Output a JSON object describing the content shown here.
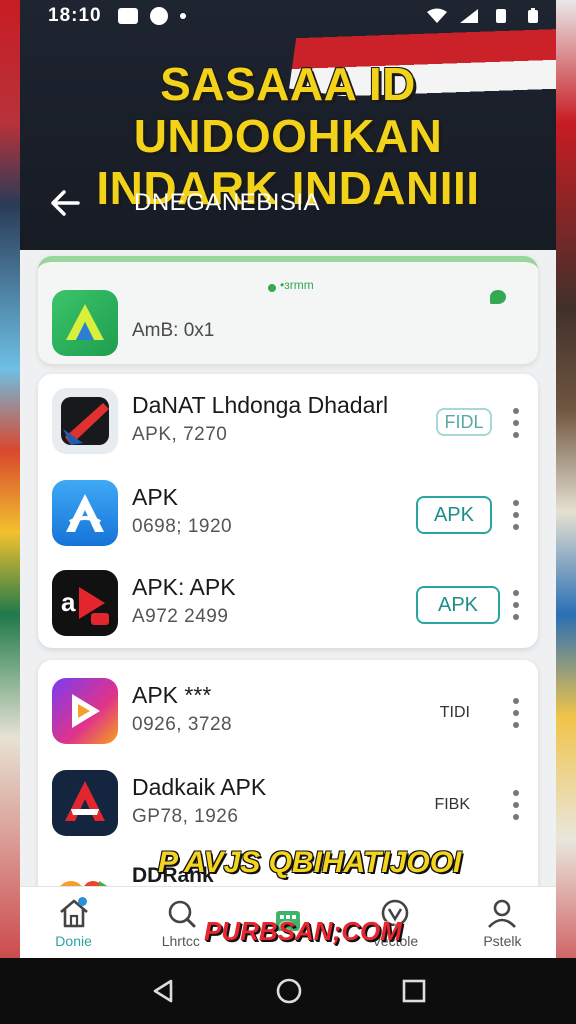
{
  "status_bar": {
    "time": "18:10"
  },
  "headline": {
    "line1": "SASAAA ID UNDOOHKAN",
    "line2": "INDARK INDANIII"
  },
  "navbar": {
    "title": "DNEGANEBISIA"
  },
  "featured": {
    "badge": "•ɜrmm",
    "meta": "AmB: 0x1"
  },
  "list1": [
    {
      "name": "DaNAT Lhdonga Dhadarl",
      "sub": "APK, 7270",
      "action": "FIDL"
    },
    {
      "name": "APK",
      "sub": "0698; 1920",
      "action": "APK"
    },
    {
      "name": "APK: APK",
      "sub": "A972 2499",
      "action": "APK"
    }
  ],
  "list2": [
    {
      "name": "APK ***",
      "sub": "0926, 3728",
      "action": "TIDI"
    },
    {
      "name": "Dadkaik APK",
      "sub": "GP78, 1926",
      "action": "FIBK"
    },
    {
      "name": "DDRank",
      "sub": "",
      "action": ""
    }
  ],
  "bottom_nav": [
    {
      "label": "Donie",
      "icon": "home-icon"
    },
    {
      "label": "Lhrtcc",
      "icon": "search-icon"
    },
    {
      "label": "",
      "icon": "app-icon"
    },
    {
      "label": "Vectole",
      "icon": "shield-icon"
    },
    {
      "label": "Pstelk",
      "icon": "profile-icon"
    }
  ],
  "promo": {
    "line1": "P  AVJS QBIHATIJOOI",
    "line2": "PURBSAN;COM"
  },
  "colors": {
    "accent": "#2aa6a0",
    "headline": "#f3d21a",
    "header_bg": "#1e2430"
  }
}
